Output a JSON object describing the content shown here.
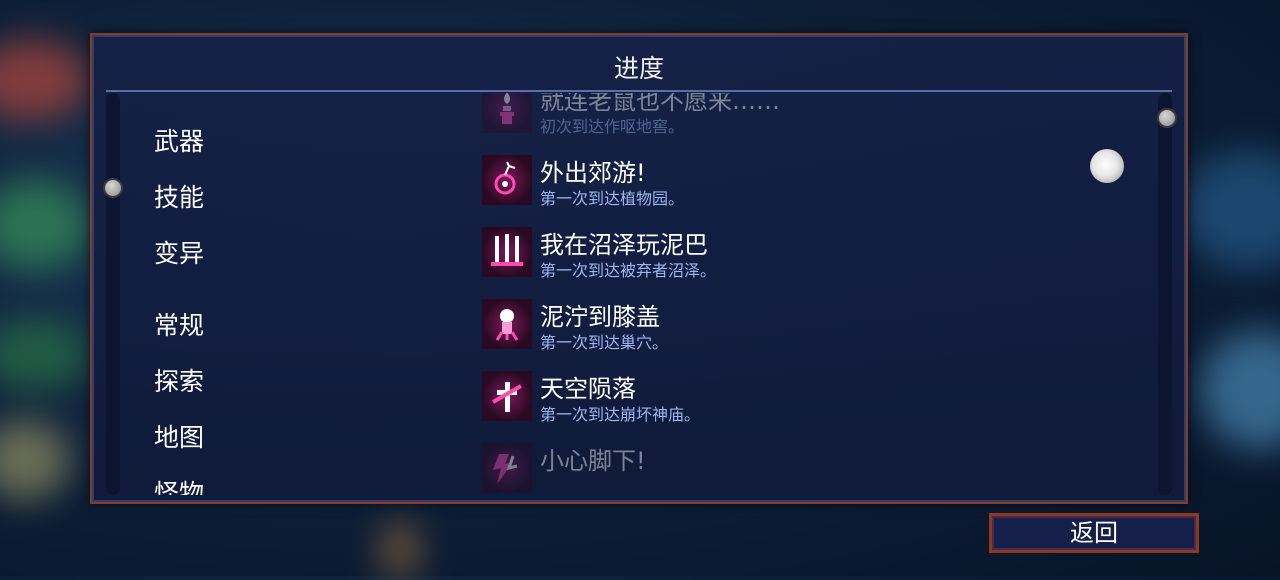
{
  "panel": {
    "title": "进度"
  },
  "categories": [
    "武器",
    "技能",
    "变异",
    "常规",
    "探索",
    "地图",
    "怪物"
  ],
  "entries": [
    {
      "title": "就连老鼠也不愿来……",
      "desc": "初次到达作呕地窖。",
      "icon": "torch-icon"
    },
    {
      "title": "外出郊游!",
      "desc": "第一次到达植物园。",
      "icon": "flower-icon"
    },
    {
      "title": "我在沼泽玩泥巴",
      "desc": "第一次到达被弃者沼泽。",
      "icon": "swamp-pillars-icon"
    },
    {
      "title": "泥泞到膝盖",
      "desc": "第一次到达巢穴。",
      "icon": "creature-icon"
    },
    {
      "title": "天空陨落",
      "desc": "第一次到达崩坏神庙。",
      "icon": "cross-ribbon-icon"
    },
    {
      "title": "小心脚下!",
      "desc": "",
      "icon": "lightning-icon"
    }
  ],
  "back_button": {
    "label": "返回"
  },
  "colors": {
    "accent": "#ff3aa8",
    "description": "#9db5f0",
    "border": "#8a3a22"
  }
}
